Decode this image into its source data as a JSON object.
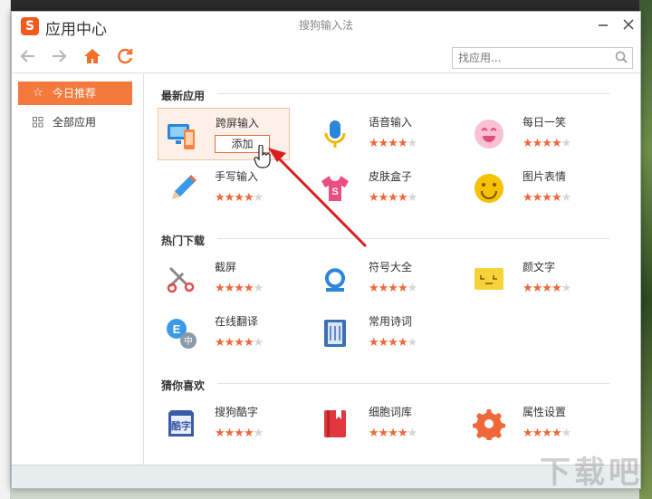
{
  "window": {
    "app_title": "应用中心",
    "caption": "搜狗输入法",
    "logo_letter": "S"
  },
  "toolbar": {
    "search_placeholder": "找应用..."
  },
  "sidebar": {
    "items": [
      {
        "label": "今日推荐",
        "icon": "star-icon",
        "active": true
      },
      {
        "label": "全部应用",
        "icon": "grid-icon",
        "active": false
      }
    ]
  },
  "sections": [
    {
      "title": "最新应用",
      "apps": [
        {
          "name": "跨屏输入",
          "icon": "cross-screen-icon",
          "stars": 4,
          "highlighted": true,
          "action": "添加"
        },
        {
          "name": "语音输入",
          "icon": "microphone-icon",
          "stars": 4
        },
        {
          "name": "每日一笑",
          "icon": "laughing-face-icon",
          "stars": 4
        },
        {
          "name": "手写输入",
          "icon": "pen-icon",
          "stars": 4
        },
        {
          "name": "皮肤盒子",
          "icon": "tshirt-icon",
          "stars": 4
        },
        {
          "name": "图片表情",
          "icon": "smiley-icon",
          "stars": 4
        }
      ]
    },
    {
      "title": "热门下载",
      "apps": [
        {
          "name": "截屏",
          "icon": "scissors-icon",
          "stars": 4
        },
        {
          "name": "符号大全",
          "icon": "omega-icon",
          "stars": 4
        },
        {
          "name": "颜文字",
          "icon": "kaomoji-icon",
          "stars": 4
        },
        {
          "name": "在线翻译",
          "icon": "translate-icon",
          "stars": 4
        },
        {
          "name": "常用诗词",
          "icon": "book-icon",
          "stars": 4
        }
      ]
    },
    {
      "title": "猜你喜欢",
      "apps": [
        {
          "name": "搜狗酷字",
          "icon": "cool-font-icon",
          "stars": 4
        },
        {
          "name": "细胞词库",
          "icon": "dictionary-icon",
          "stars": 4
        },
        {
          "name": "属性设置",
          "icon": "gear-icon",
          "stars": 4
        }
      ]
    }
  ],
  "watermark": "下载吧",
  "colors": {
    "accent": "#f37a3c",
    "star": "#f0683a",
    "star_off": "#d6d6d6",
    "brand": "#f3591c"
  }
}
